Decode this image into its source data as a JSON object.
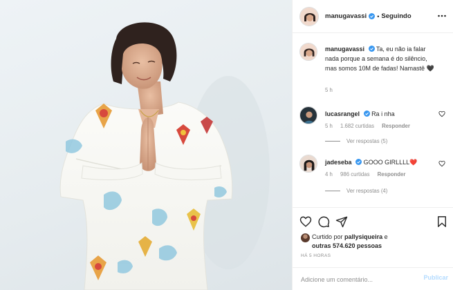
{
  "post": {
    "author": "manugavassi",
    "separator": "•",
    "follow_label": "Seguindo"
  },
  "caption": {
    "author": "manugavassi",
    "text": "Ta, eu não ia falar nada porque a semana é do silêncio, mas somos 10M de fadas! Namastê",
    "emoji": "🖤",
    "age": "5 h"
  },
  "comments": [
    {
      "author": "lucasrangel",
      "text": "Ra i nha",
      "age": "5 h",
      "likes": "1.682 curtidas",
      "reply": "Responder",
      "view_replies": "Ver respostas (5)"
    },
    {
      "author": "jadeseba",
      "text": "GOOO GIRLLLL",
      "emoji": "❤️",
      "age": "4 h",
      "likes": "986 curtidas",
      "reply": "Responder",
      "view_replies": "Ver respostas (4)"
    }
  ],
  "likes": {
    "prefix": "Curtido por",
    "user": "pallysiqueira",
    "connector": "e",
    "others": "outras 574.620 pessoas"
  },
  "timestamp": "HÁ 5 HORAS",
  "comment_input": {
    "placeholder": "Adicione um comentário...",
    "value": ""
  },
  "publish_label": "Publicar",
  "colors": {
    "verified": "#3897f0",
    "muted": "#8e8e8e",
    "publish_disabled": "#b3dbff"
  },
  "icons": [
    "verified-badge-icon",
    "more-options-icon",
    "heart-icon",
    "comment-icon",
    "share-icon",
    "bookmark-icon"
  ]
}
